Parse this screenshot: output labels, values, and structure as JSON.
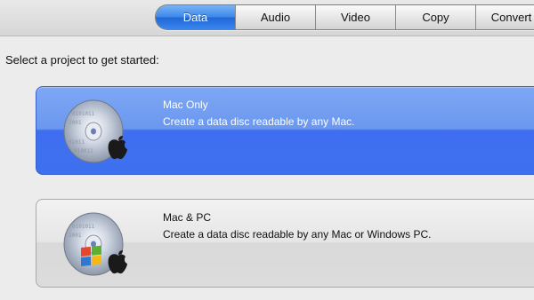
{
  "toolbar": {
    "tabs": [
      {
        "label": "Data",
        "active": true
      },
      {
        "label": "Audio",
        "active": false
      },
      {
        "label": "Video",
        "active": false
      },
      {
        "label": "Copy",
        "active": false
      },
      {
        "label": "Convert",
        "active": false
      }
    ]
  },
  "prompt": "Select a project to get started:",
  "projects": [
    {
      "title": "Mac Only",
      "description": "Create a data disc readable by any Mac.",
      "selected": true,
      "icon": "data-disc-apple-icon"
    },
    {
      "title": "Mac & PC",
      "description": "Create a data disc readable by any Mac or Windows PC.",
      "selected": false,
      "icon": "data-disc-apple-windows-icon"
    }
  ],
  "colors": {
    "accent": "#3d70ef",
    "active_tab": "#3c86ea"
  }
}
